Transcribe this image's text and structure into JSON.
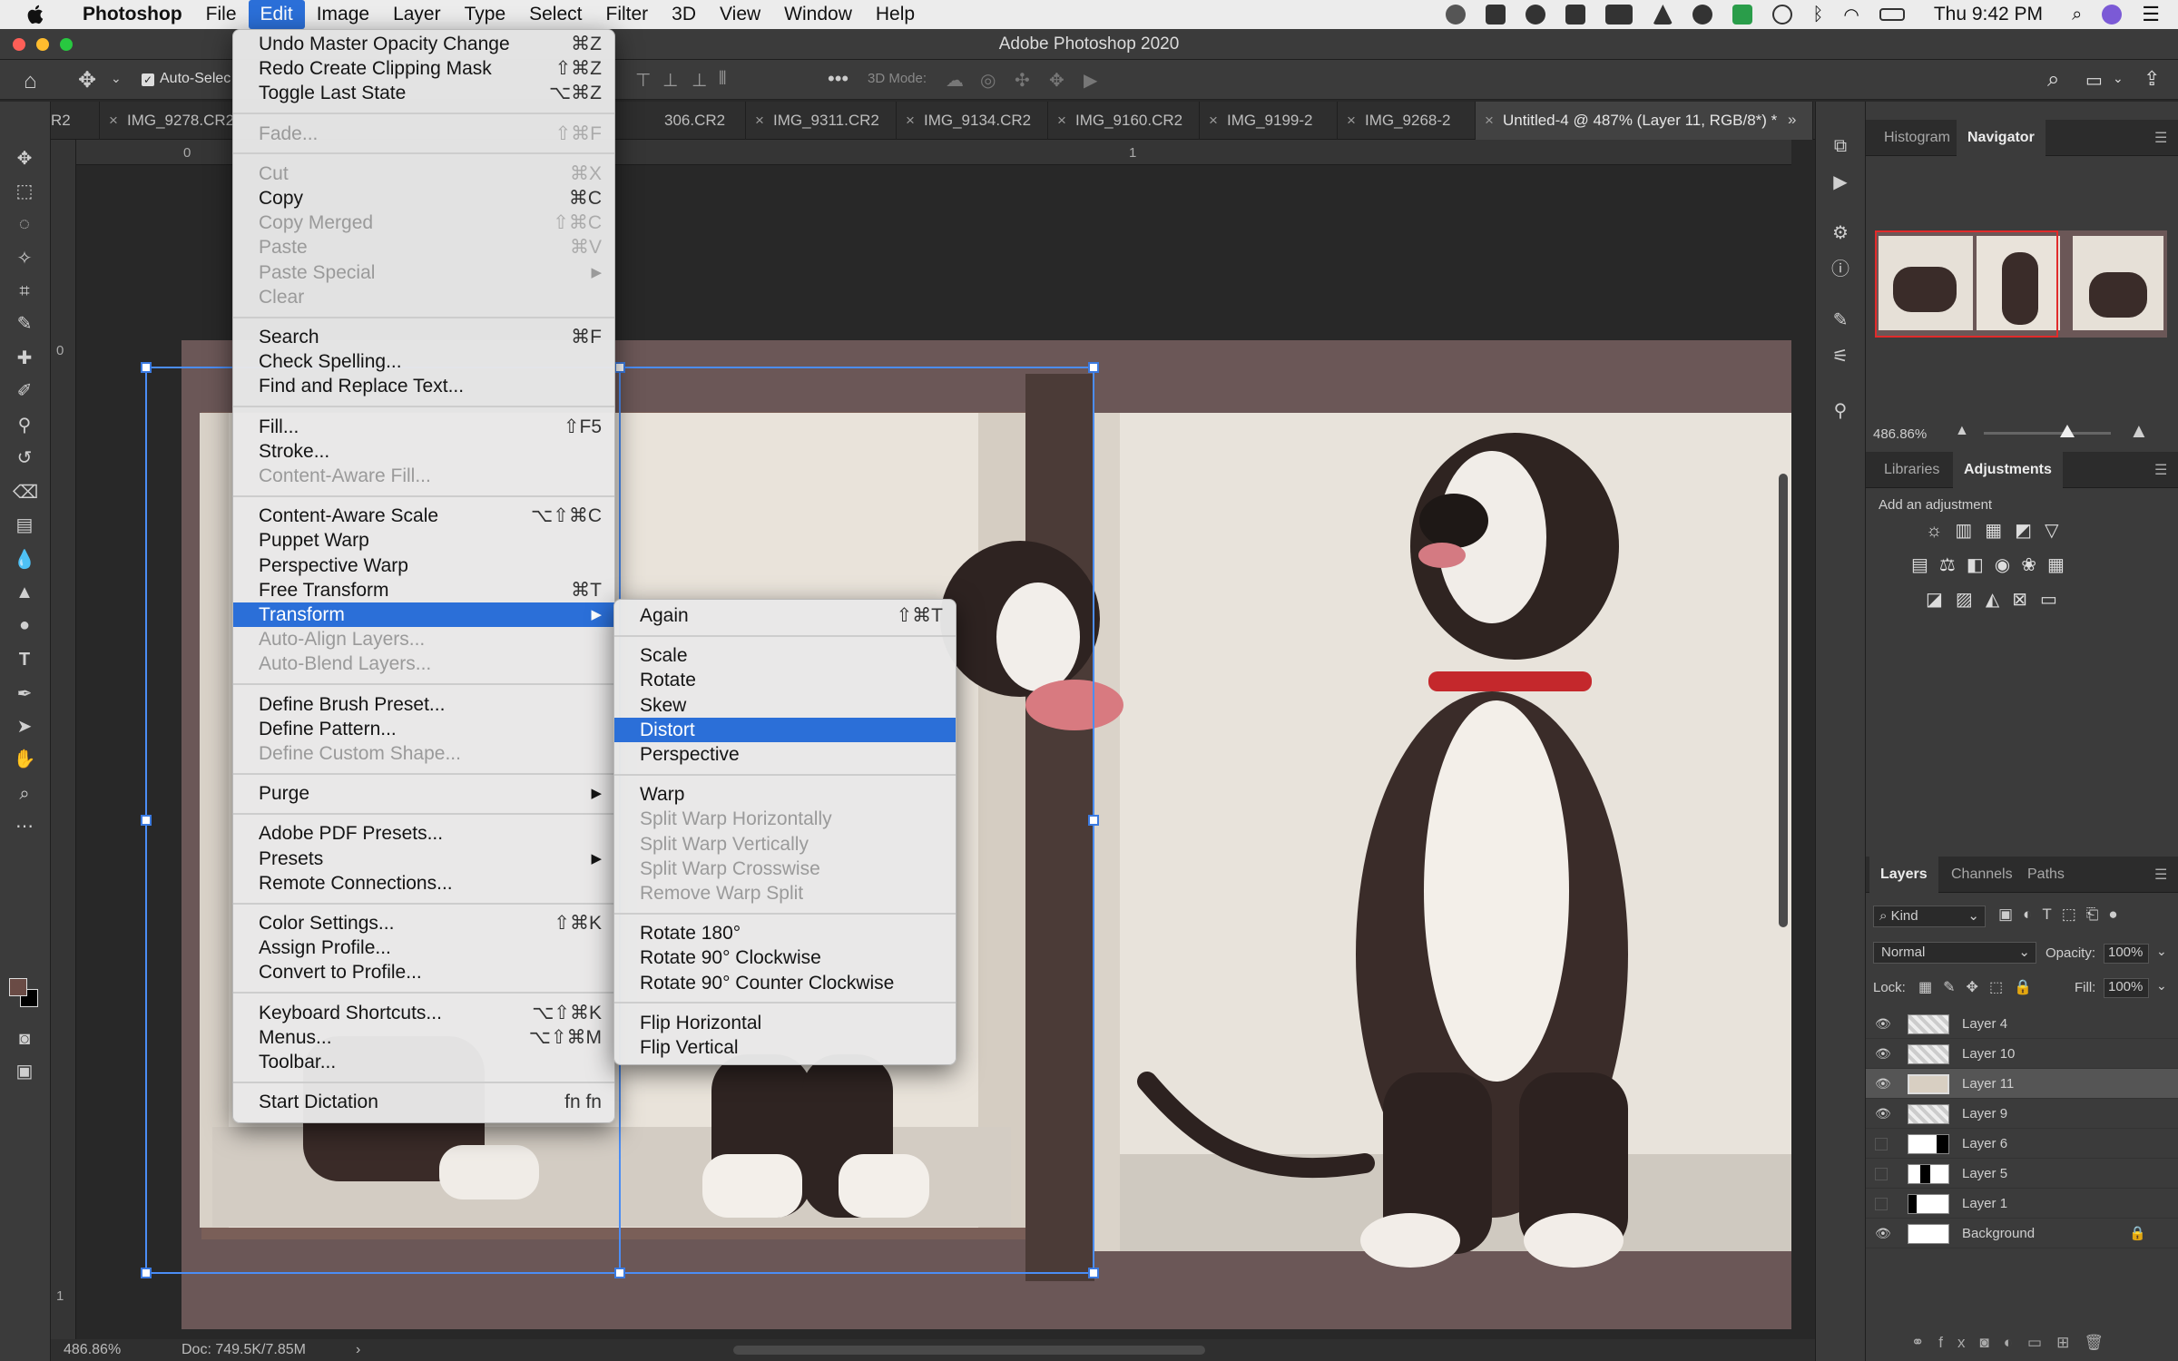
{
  "menubar": {
    "app_name": "Photoshop",
    "items": [
      "File",
      "Edit",
      "Image",
      "Layer",
      "Type",
      "Select",
      "Filter",
      "3D",
      "View",
      "Window",
      "Help"
    ],
    "active": "Edit",
    "clock": "Thu 9:42 PM"
  },
  "window": {
    "title": "Adobe Photoshop 2020"
  },
  "options_bar": {
    "auto_select_label": "Auto-Selec",
    "mode_label": "3D Mode:"
  },
  "tabs": [
    {
      "label": "R2"
    },
    {
      "label": "IMG_9278.CR2"
    },
    {
      "label": "306.CR2"
    },
    {
      "label": "IMG_9311.CR2"
    },
    {
      "label": "IMG_9134.CR2"
    },
    {
      "label": "IMG_9160.CR2"
    },
    {
      "label": "IMG_9199-2"
    },
    {
      "label": "IMG_9268-2"
    },
    {
      "label": "Untitled-4 @ 487% (Layer 11, RGB/8*) *"
    }
  ],
  "rulers": {
    "h0": "0",
    "h1": "1",
    "v0": "0",
    "v1": "1"
  },
  "status": {
    "zoom": "486.86%",
    "doc": "Doc: 749.5K/7.85M"
  },
  "edit_menu": [
    {
      "label": "Undo Master Opacity Change",
      "shortcut": "⌘Z",
      "enabled": true
    },
    {
      "label": "Redo Create Clipping Mask",
      "shortcut": "⇧⌘Z",
      "enabled": true
    },
    {
      "label": "Toggle Last State",
      "shortcut": "⌥⌘Z",
      "enabled": true
    },
    {
      "sep": true
    },
    {
      "label": "Fade...",
      "shortcut": "⇧⌘F",
      "enabled": false
    },
    {
      "sep": true
    },
    {
      "label": "Cut",
      "shortcut": "⌘X",
      "enabled": false
    },
    {
      "label": "Copy",
      "shortcut": "⌘C",
      "enabled": true
    },
    {
      "label": "Copy Merged",
      "shortcut": "⇧⌘C",
      "enabled": false
    },
    {
      "label": "Paste",
      "shortcut": "⌘V",
      "enabled": false
    },
    {
      "label": "Paste Special",
      "shortcut": "",
      "enabled": false,
      "submenu": true
    },
    {
      "label": "Clear",
      "shortcut": "",
      "enabled": false
    },
    {
      "sep": true
    },
    {
      "label": "Search",
      "shortcut": "⌘F",
      "enabled": true
    },
    {
      "label": "Check Spelling...",
      "shortcut": "",
      "enabled": true
    },
    {
      "label": "Find and Replace Text...",
      "shortcut": "",
      "enabled": true
    },
    {
      "sep": true
    },
    {
      "label": "Fill...",
      "shortcut": "⇧F5",
      "enabled": true
    },
    {
      "label": "Stroke...",
      "shortcut": "",
      "enabled": true
    },
    {
      "label": "Content-Aware Fill...",
      "shortcut": "",
      "enabled": false
    },
    {
      "sep": true
    },
    {
      "label": "Content-Aware Scale",
      "shortcut": "⌥⇧⌘C",
      "enabled": true
    },
    {
      "label": "Puppet Warp",
      "shortcut": "",
      "enabled": true
    },
    {
      "label": "Perspective Warp",
      "shortcut": "",
      "enabled": true
    },
    {
      "label": "Free Transform",
      "shortcut": "⌘T",
      "enabled": true
    },
    {
      "label": "Transform",
      "shortcut": "",
      "enabled": true,
      "submenu": true,
      "highlighted": true
    },
    {
      "label": "Auto-Align Layers...",
      "shortcut": "",
      "enabled": false
    },
    {
      "label": "Auto-Blend Layers...",
      "shortcut": "",
      "enabled": false
    },
    {
      "sep": true
    },
    {
      "label": "Define Brush Preset...",
      "shortcut": "",
      "enabled": true
    },
    {
      "label": "Define Pattern...",
      "shortcut": "",
      "enabled": true
    },
    {
      "label": "Define Custom Shape...",
      "shortcut": "",
      "enabled": false
    },
    {
      "sep": true
    },
    {
      "label": "Purge",
      "shortcut": "",
      "enabled": true,
      "submenu": true
    },
    {
      "sep": true
    },
    {
      "label": "Adobe PDF Presets...",
      "shortcut": "",
      "enabled": true
    },
    {
      "label": "Presets",
      "shortcut": "",
      "enabled": true,
      "submenu": true
    },
    {
      "label": "Remote Connections...",
      "shortcut": "",
      "enabled": true
    },
    {
      "sep": true
    },
    {
      "label": "Color Settings...",
      "shortcut": "⇧⌘K",
      "enabled": true
    },
    {
      "label": "Assign Profile...",
      "shortcut": "",
      "enabled": true
    },
    {
      "label": "Convert to Profile...",
      "shortcut": "",
      "enabled": true
    },
    {
      "sep": true
    },
    {
      "label": "Keyboard Shortcuts...",
      "shortcut": "⌥⇧⌘K",
      "enabled": true
    },
    {
      "label": "Menus...",
      "shortcut": "⌥⇧⌘M",
      "enabled": true
    },
    {
      "label": "Toolbar...",
      "shortcut": "",
      "enabled": true
    },
    {
      "sep": true
    },
    {
      "label": "Start Dictation",
      "shortcut": "fn fn",
      "enabled": true
    }
  ],
  "transform_menu": [
    {
      "label": "Again",
      "shortcut": "⇧⌘T",
      "enabled": true
    },
    {
      "sep": true
    },
    {
      "label": "Scale",
      "shortcut": "",
      "enabled": true
    },
    {
      "label": "Rotate",
      "shortcut": "",
      "enabled": true
    },
    {
      "label": "Skew",
      "shortcut": "",
      "enabled": true
    },
    {
      "label": "Distort",
      "shortcut": "",
      "enabled": true,
      "highlighted": true
    },
    {
      "label": "Perspective",
      "shortcut": "",
      "enabled": true
    },
    {
      "sep": true
    },
    {
      "label": "Warp",
      "shortcut": "",
      "enabled": true
    },
    {
      "label": "Split Warp Horizontally",
      "shortcut": "",
      "enabled": false
    },
    {
      "label": "Split Warp Vertically",
      "shortcut": "",
      "enabled": false
    },
    {
      "label": "Split Warp Crosswise",
      "shortcut": "",
      "enabled": false
    },
    {
      "label": "Remove Warp Split",
      "shortcut": "",
      "enabled": false
    },
    {
      "sep": true
    },
    {
      "label": "Rotate 180°",
      "shortcut": "",
      "enabled": true
    },
    {
      "label": "Rotate 90° Clockwise",
      "shortcut": "",
      "enabled": true
    },
    {
      "label": "Rotate 90° Counter Clockwise",
      "shortcut": "",
      "enabled": true
    },
    {
      "sep": true
    },
    {
      "label": "Flip Horizontal",
      "shortcut": "",
      "enabled": true
    },
    {
      "label": "Flip Vertical",
      "shortcut": "",
      "enabled": true
    }
  ],
  "panels": {
    "top_tabs": [
      "Histogram",
      "Navigator"
    ],
    "nav_zoom": "486.86%",
    "mid_tabs": [
      "Libraries",
      "Adjustments"
    ],
    "add_adjustment": "Add an adjustment",
    "layer_tabs": [
      "Layers",
      "Channels",
      "Paths"
    ],
    "kind": "Kind",
    "blend_mode": "Normal",
    "opacity_label": "Opacity:",
    "opacity": "100%",
    "lock_label": "Lock:",
    "fill_label": "Fill:",
    "fill": "100%",
    "layers": [
      {
        "name": "Layer 4",
        "visible": true,
        "selected": false
      },
      {
        "name": "Layer 10",
        "visible": true,
        "selected": false
      },
      {
        "name": "Layer 11",
        "visible": true,
        "selected": true
      },
      {
        "name": "Layer 9",
        "visible": true,
        "selected": false
      },
      {
        "name": "Layer 6",
        "visible": false,
        "selected": false
      },
      {
        "name": "Layer 5",
        "visible": false,
        "selected": false
      },
      {
        "name": "Layer 1",
        "visible": false,
        "selected": false
      },
      {
        "name": "Background",
        "visible": true,
        "selected": false,
        "locked": true
      }
    ]
  },
  "colors": {
    "menu_highlight": "#2b6fd8",
    "canvas_frame": "#6b5757",
    "box_interior": "#ece7df"
  }
}
